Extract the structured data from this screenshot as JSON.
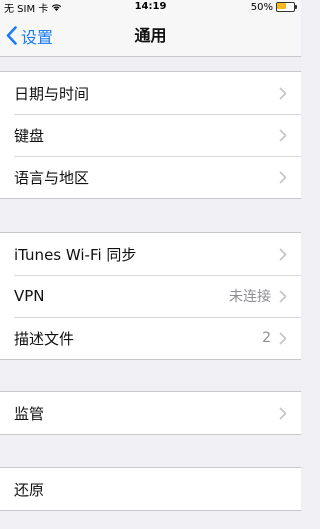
{
  "status_bar": {
    "carrier": "无 SIM 卡",
    "time": "14:19",
    "battery_text": "50%",
    "battery_level": 0.5,
    "battery_color": "#f5b91e"
  },
  "nav": {
    "back_label": "设置",
    "title": "通用",
    "accent_color": "#1a7cf5"
  },
  "groups": [
    {
      "rows": [
        {
          "label": "日期与时间",
          "detail": ""
        },
        {
          "label": "键盘",
          "detail": ""
        },
        {
          "label": "语言与地区",
          "detail": ""
        }
      ]
    },
    {
      "rows": [
        {
          "label": "iTunes Wi-Fi 同步",
          "detail": ""
        },
        {
          "label": "VPN",
          "detail": "未连接"
        },
        {
          "label": "描述文件",
          "detail": "2"
        }
      ]
    },
    {
      "rows": [
        {
          "label": "监管",
          "detail": ""
        }
      ]
    },
    {
      "rows": [
        {
          "label": "还原",
          "detail": ""
        }
      ]
    }
  ],
  "icons": {
    "row_chevron": "chevron-right-icon",
    "back": "chevron-left-icon",
    "wifi": "wifi-icon",
    "battery": "battery-icon"
  }
}
